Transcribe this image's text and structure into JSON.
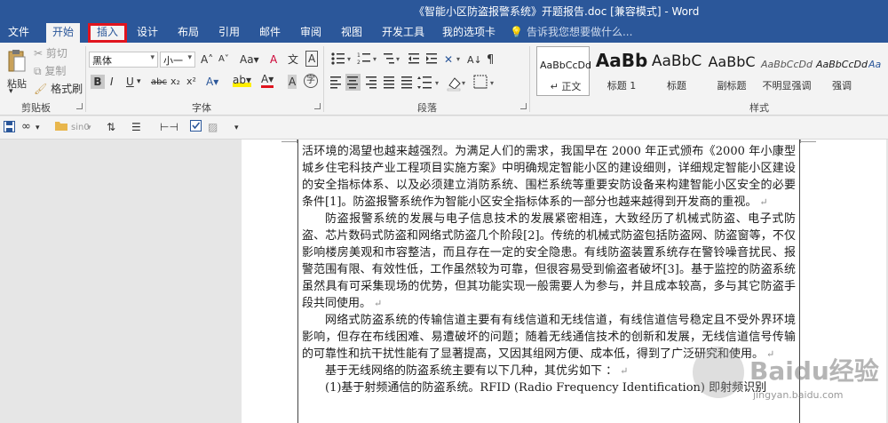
{
  "window": {
    "title": "《智能小区防盗报警系统》开题报告.doc [兼容模式] - Word"
  },
  "tabs": [
    {
      "label": "文件"
    },
    {
      "label": "开始"
    },
    {
      "label": "插入"
    },
    {
      "label": "设计"
    },
    {
      "label": "布局"
    },
    {
      "label": "引用"
    },
    {
      "label": "邮件"
    },
    {
      "label": "审阅"
    },
    {
      "label": "视图"
    },
    {
      "label": "开发工具"
    },
    {
      "label": "我的选项卡"
    }
  ],
  "tell_me": "告诉我您想要做什么...",
  "colors": {
    "accent": "#2b579a",
    "highlight": "#e0141e",
    "ribbon_bg": "#f3f3f3"
  },
  "clipboard": {
    "paste": "粘贴",
    "cut": "剪切",
    "copy": "复制",
    "format_painter": "格式刷",
    "group": "剪贴板"
  },
  "font": {
    "family": "黑体",
    "size": "小一",
    "grow": "A",
    "shrink": "A",
    "change_case": "Aa",
    "clear_format": "A",
    "phonetic": "文",
    "char_border": "A",
    "bold": "B",
    "italic": "I",
    "underline": "U",
    "strike": "abc",
    "subscript": "x₂",
    "superscript": "x²",
    "text_effect": "A",
    "highlight": "ab",
    "font_color": "A",
    "char_shading": "A",
    "enclose": "字",
    "group": "字体"
  },
  "paragraph": {
    "group": "段落"
  },
  "styles": {
    "group": "样式",
    "items": [
      {
        "sample": "AaBbCcDd",
        "name": "正文",
        "mark": "↵"
      },
      {
        "sample": "AaBb",
        "name": "标题 1"
      },
      {
        "sample": "AaBbC",
        "name": "标题"
      },
      {
        "sample": "AaBbC",
        "name": "副标题"
      },
      {
        "sample": "AaBbCcDd",
        "name": "不明显强调"
      },
      {
        "sample": "AaBbCcDd",
        "name": "强调"
      },
      {
        "sample": "Aa",
        "name": ""
      }
    ]
  },
  "qat": {
    "font_label": "sin0"
  },
  "document": {
    "paragraphs": [
      {
        "text": "活环境的渴望也越来越强烈。为满足人们的需求，我国早在 2000 年正式颁布《2000 年小康型城乡住宅科技产业工程项目实施方案》中明确规定智能小区的建设细则，详细规定智能小区建设的安全指标体系、以及必须建立消防系统、围栏系统等重要安防设备来构建智能小区安全的必要条件[1]。防盗报警系统作为智能小区安全指标体系的一部分也越来越得到开发商的重视。",
        "indent": false
      },
      {
        "text": "防盗报警系统的发展与电子信息技术的发展紧密相连，大致经历了机械式防盗、电子式防盗、芯片数码式防盗和网络式防盗几个阶段[2]。传统的机械式防盗包括防盗网、防盗窗等，不仅影响楼房美观和市容整洁，而且存在一定的安全隐患。有线防盗装置系统存在警铃噪音扰民、报警范围有限、有效性低，工作虽然较为可靠，但很容易受到偷盗者破坏[3]。基于监控的防盗系统虽然具有可采集现场的优势，但其功能实现一般需要人为参与，并且成本较高，多与其它防盗手段共同使用。",
        "indent": true
      },
      {
        "text": "网络式防盗系统的传输信道主要有有线信道和无线信道，有线信道信号稳定且不受外界环境影响，但存在布线困难、易遭破坏的问题；随着无线通信技术的创新和发展，无线信道信号传输的可靠性和抗干扰性能有了显著提高，又因其组网方便、成本低，得到了广泛研究和使用。",
        "indent": true
      },
      {
        "text": "基于无线网络的防盗系统主要有以下几种，其优劣如下 ：",
        "indent": true
      },
      {
        "text": "(1)基于射频通信的防盗系统。RFID (Radio Frequency Identification) 即射频识别",
        "indent": true
      }
    ],
    "para_mark": "↵"
  },
  "watermark": {
    "big": "Baidu经验",
    "small": "jingyan.baidu.com"
  }
}
